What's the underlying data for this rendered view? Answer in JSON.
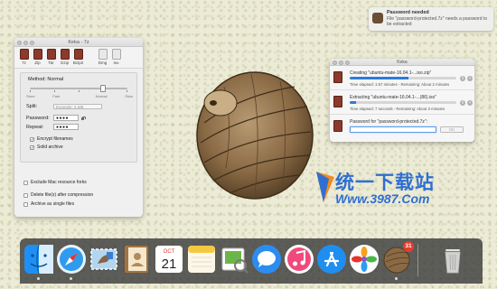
{
  "notification": {
    "title": "Password needed",
    "body": "File \"password-protected.7z\" needs a password to be extracted"
  },
  "keka_window": {
    "title": "Keka - 7z",
    "formats": [
      {
        "label": "7z",
        "icon": "archive-7z-icon"
      },
      {
        "label": "Zip",
        "icon": "archive-zip-icon"
      },
      {
        "label": "Tar",
        "icon": "archive-tar-icon"
      },
      {
        "label": "Gzip",
        "icon": "archive-gzip-icon"
      },
      {
        "label": "Bzip2",
        "icon": "archive-bzip2-icon"
      },
      {
        "label": "Dmg",
        "icon": "disk-image-icon"
      },
      {
        "label": "Iso",
        "icon": "disk-iso-icon"
      }
    ],
    "method_label": "Method: Normal",
    "method_level": 0.75,
    "speed_labels": [
      "Store",
      "Fast",
      "",
      "Normal",
      "Slow"
    ],
    "split_label": "Split:",
    "split_value": "Example: 5 MB",
    "password_label": "Password:",
    "password_value": "●●●●",
    "repeat_label": "Repeat:",
    "repeat_value": "●●●●",
    "encrypt_filenames": {
      "label": "Encrypt filenames",
      "checked": true
    },
    "solid_archive": {
      "label": "Solid archive",
      "checked": true
    },
    "exclude_forks": {
      "label": "Exclude Mac resource forks",
      "checked": false
    },
    "delete_after": {
      "label": "Delete file(s) after compression",
      "checked": false
    },
    "single_files": {
      "label": "Archive as single files",
      "checked": false
    }
  },
  "progress_window": {
    "title": "Keka",
    "tasks": [
      {
        "name": "Creating \"ubuntu-mate-16.04.1-...iso.zip\"",
        "progress": 0.55,
        "time": "Time elapsed: 1:57 minutes - Remaining: About 2 minutes"
      },
      {
        "name": "Extracting \"ubuntu-mate-16.04.1-...(86).iso\"",
        "progress": 0.06,
        "time": "Time elapsed: 7 seconds - Remaining: About 3 minutes"
      }
    ],
    "password_prompt": "Password for \"password-protected.7z\":",
    "ok_label": "OK"
  },
  "watermark": {
    "chinese": "统一下载站",
    "url": "Www.3987.Com"
  },
  "dock": {
    "calendar_month": "OCT",
    "calendar_day": "21",
    "keka_badge": "31",
    "items": [
      "finder-icon",
      "safari-icon",
      "mail-icon",
      "contacts-icon",
      "calendar-icon",
      "notes-icon",
      "preview-icon",
      "messages-icon",
      "itunes-icon",
      "app-store-icon",
      "photos-icon",
      "keka-icon",
      "trash-icon"
    ]
  }
}
